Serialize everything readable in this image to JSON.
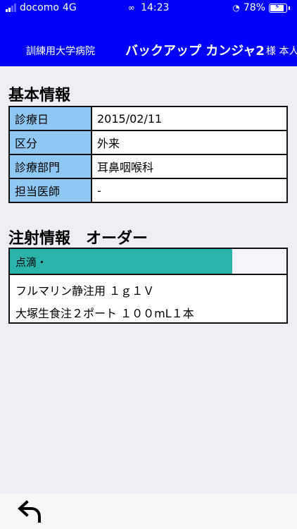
{
  "status_bar": {
    "carrier": "docomo",
    "network": "4G",
    "time": "14:23",
    "battery": "78%",
    "icons": [
      "signal-icon",
      "screen-share-icon",
      "rotation-lock-icon",
      "battery-charging-icon"
    ]
  },
  "header": {
    "hospital": "訓練用大学病院",
    "patient_name": "バックアップ カンジャ2",
    "patient_suffix": "様 本人"
  },
  "basic_info": {
    "title": "基本情報",
    "rows": [
      {
        "label": "診療日",
        "value": "2015/02/11"
      },
      {
        "label": "区分",
        "value": "外来"
      },
      {
        "label": "診療部門",
        "value": "耳鼻咽喉科"
      },
      {
        "label": "担当医師",
        "value": "-"
      }
    ]
  },
  "injection": {
    "title": "注射情報　オーダー",
    "category": "点滴・",
    "items": [
      "フルマリン静注用 １ｇ１Ｖ",
      "大塚生食注２ポート １００mL１本"
    ]
  },
  "footer": {
    "back_icon": "back-arrow-icon"
  },
  "colors": {
    "header_bg": "#0000ff",
    "label_bg": "#8fc8f2",
    "drip_bar": "#2bb3ab",
    "page_bg": "#efeef4"
  }
}
